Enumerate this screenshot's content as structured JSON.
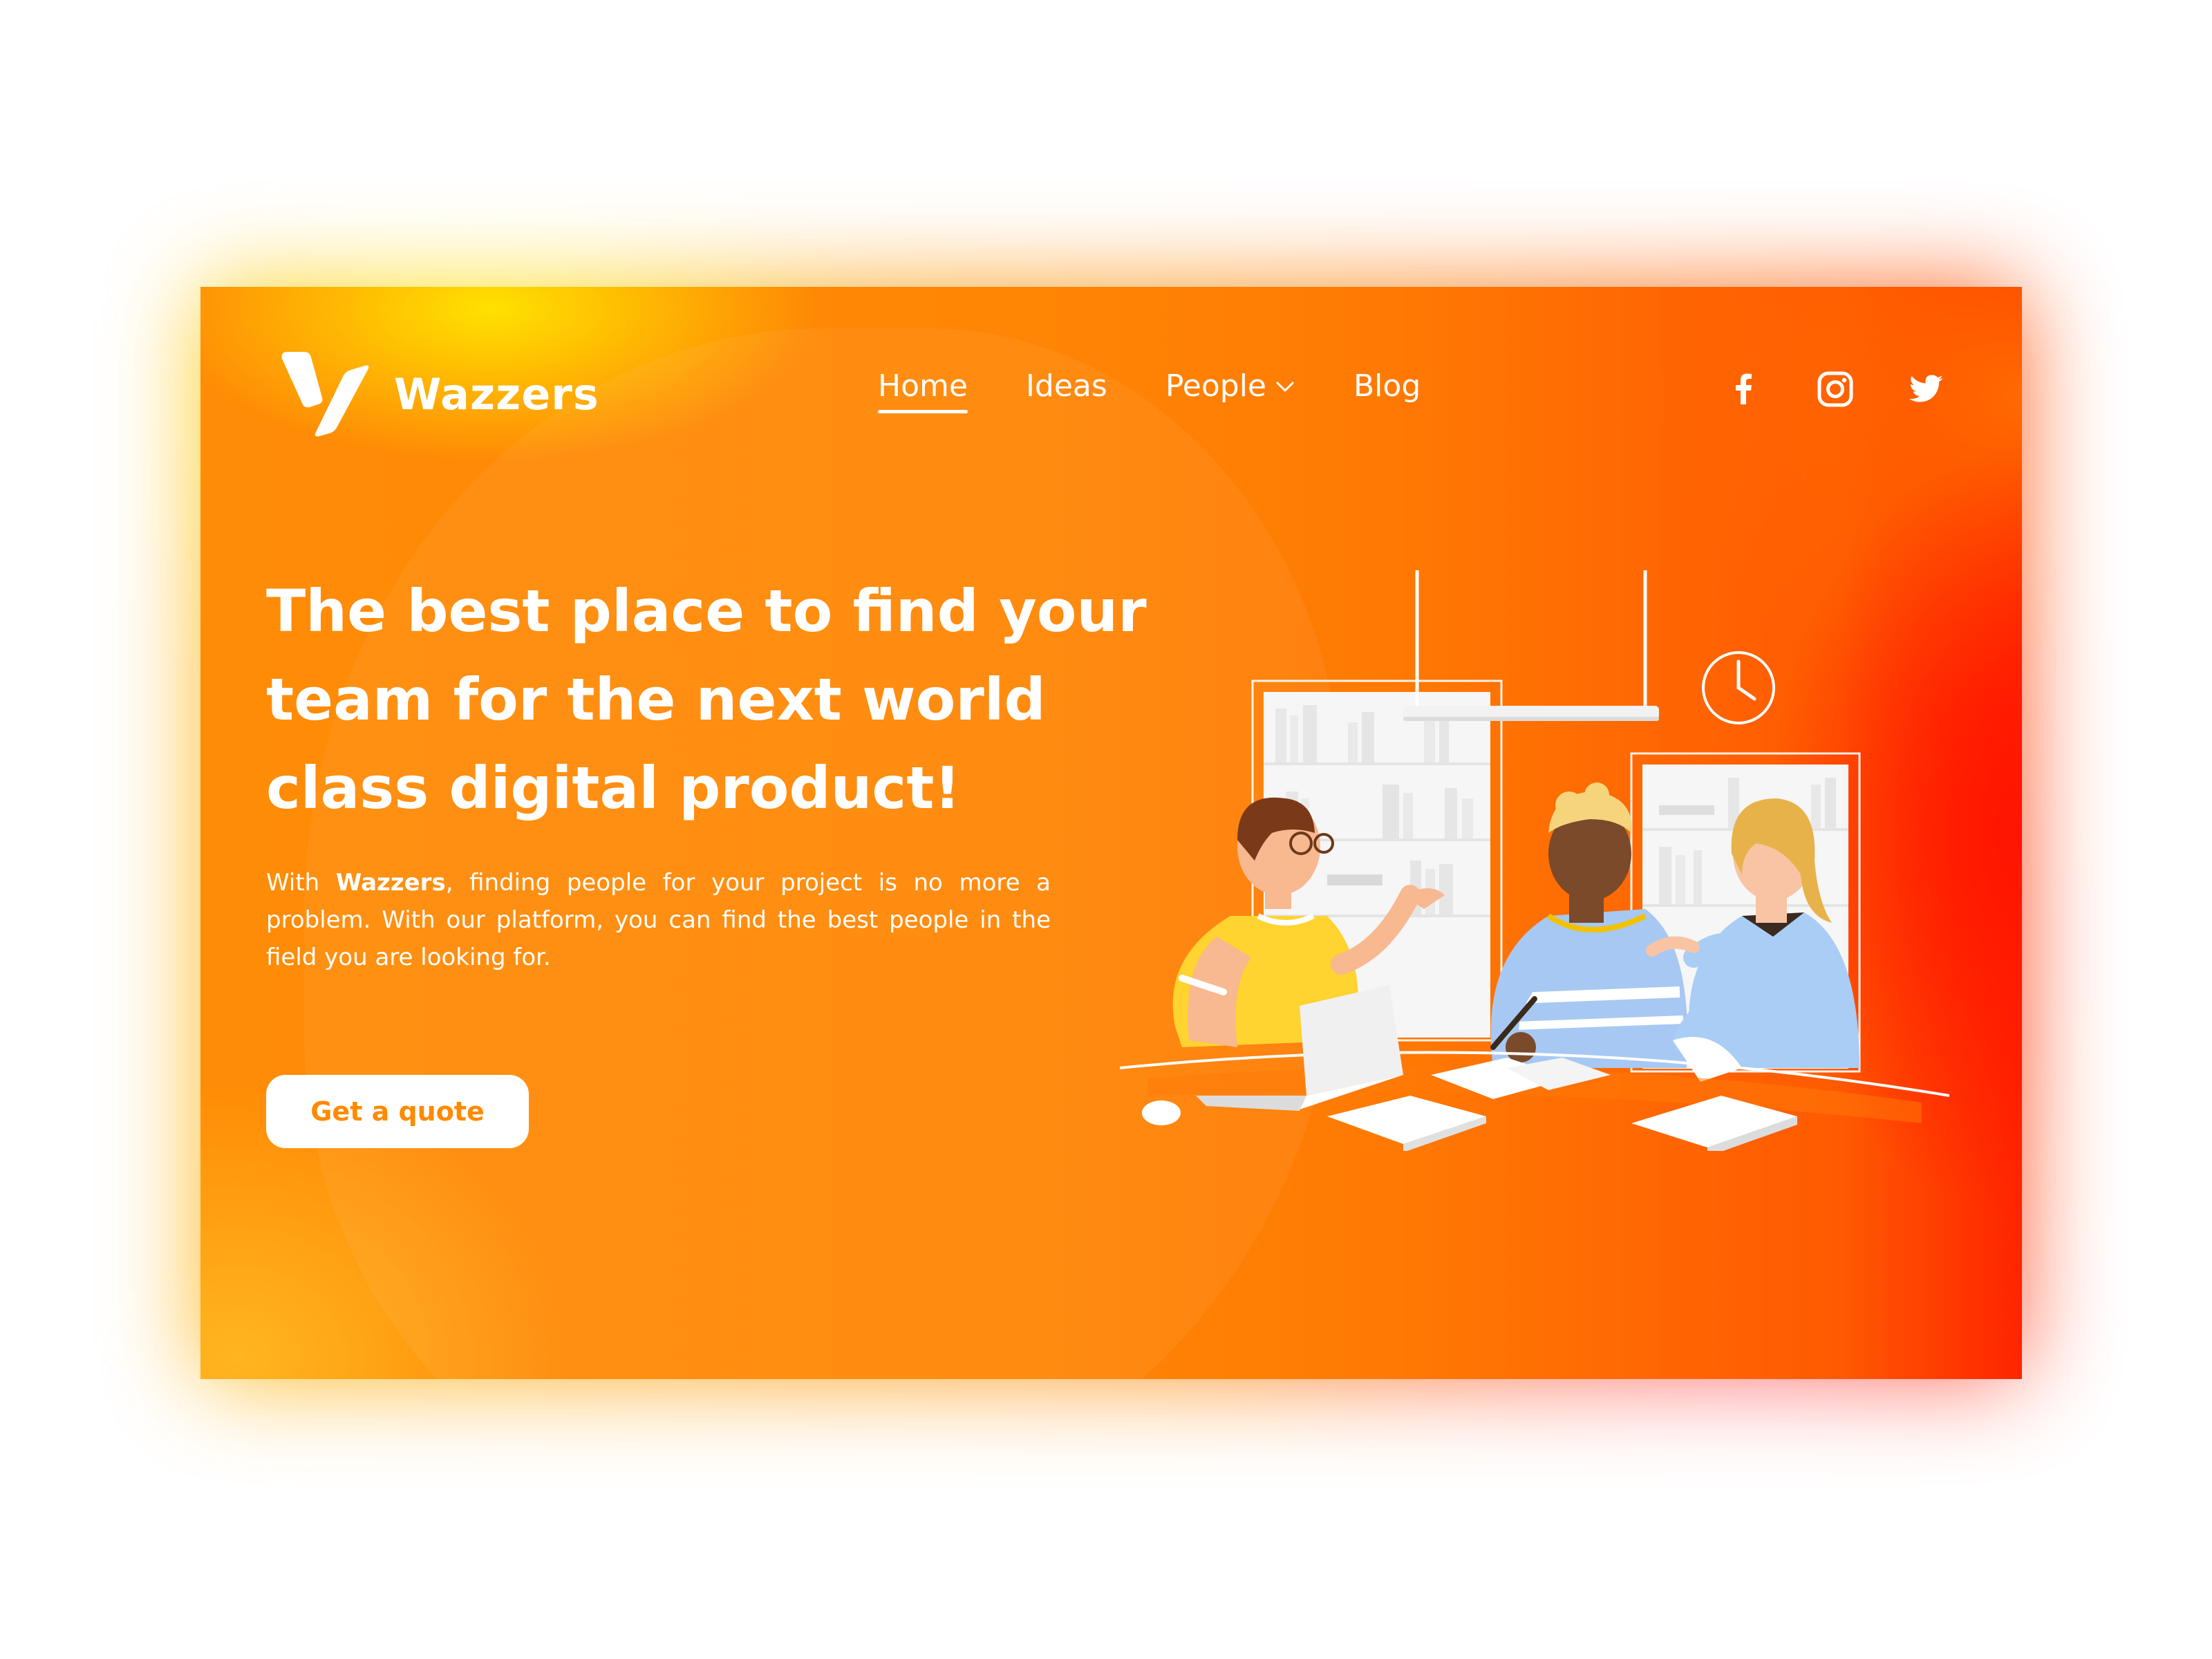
{
  "brand": {
    "name": "Wazzers",
    "logo_icon": "wazzers-logo-icon"
  },
  "nav": {
    "items": [
      {
        "label": "Home",
        "active": true
      },
      {
        "label": "Ideas",
        "active": false
      },
      {
        "label": "People",
        "active": false,
        "dropdown": true
      },
      {
        "label": "Blog",
        "active": false
      }
    ]
  },
  "social": {
    "icons": [
      "facebook-icon",
      "instagram-icon",
      "twitter-icon"
    ]
  },
  "hero": {
    "headline": "The best place to find your team for the next world class digital product!",
    "sub_prefix": "With ",
    "sub_brand": "Wazzers",
    "sub_suffix": ", finding people for your project is no more a problem. With our platform, you can find the best people in the field you are looking for.",
    "cta_label": "Get a quote"
  },
  "colors": {
    "accent": "#ff8a00",
    "accent_red": "#ff2400",
    "accent_yellow": "#ffe100",
    "text_on_accent": "#ffffff"
  }
}
